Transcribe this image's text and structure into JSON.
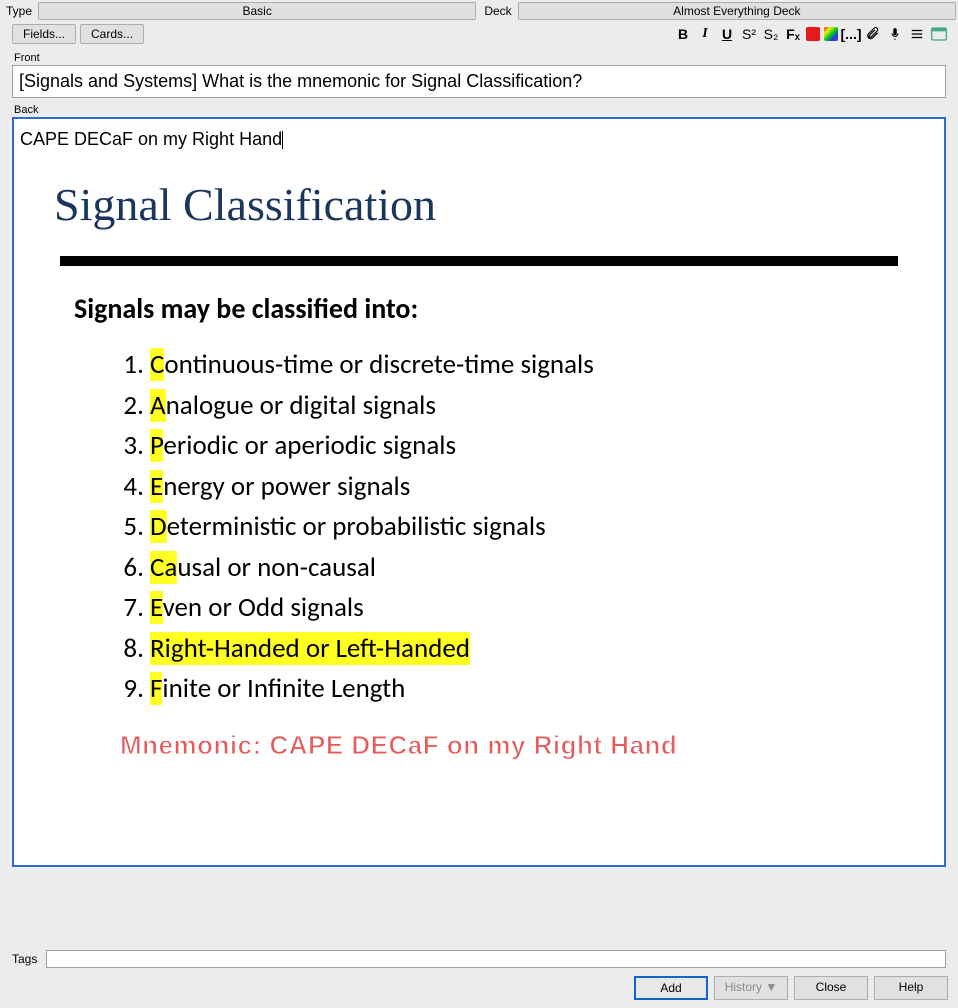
{
  "top": {
    "type_label": "Type",
    "type_value": "Basic",
    "deck_label": "Deck",
    "deck_value": "Almost Everything Deck"
  },
  "buttons": {
    "fields": "Fields...",
    "cards": "Cards..."
  },
  "toolbar": {
    "bold": "B",
    "italic": "I",
    "underline": "U",
    "sup": "S²",
    "sub": "S₂",
    "erase": "Fₓ",
    "cloze": "[...]",
    "attach": "attach-icon",
    "mic": "mic-icon",
    "menu": "menu-icon",
    "more": "more-icon"
  },
  "labels": {
    "front": "Front",
    "back": "Back",
    "tags": "Tags"
  },
  "front_text": "[Signals and Systems] What is the mnemonic for Signal Classification?",
  "back_text": "CAPE DECaF on my Right Hand",
  "slide": {
    "title": "Signal Classification",
    "subtitle": "Signals may be classified into:",
    "items": [
      {
        "hl": "C",
        "rest": "ontinuous-time or discrete-time signals"
      },
      {
        "hl": "A",
        "rest": "nalogue or digital signals"
      },
      {
        "hl": "P",
        "rest": "eriodic or aperiodic signals"
      },
      {
        "hl": "E",
        "rest": "nergy or power signals"
      },
      {
        "hl": "D",
        "rest": "eterministic or probabilistic signals"
      },
      {
        "hl": "Ca",
        "rest": "usal or non-causal"
      },
      {
        "hl": "E",
        "rest": "ven or Odd signals"
      },
      {
        "full_hl": "Right-Handed or Left-Handed"
      },
      {
        "hl": "F",
        "rest": "inite or Infinite Length"
      }
    ],
    "mnemonic": "Mnemonic: CAPE DECaF on my Right Hand"
  },
  "footer": {
    "add": "Add",
    "history": "History ▼",
    "close": "Close",
    "help": "Help"
  }
}
